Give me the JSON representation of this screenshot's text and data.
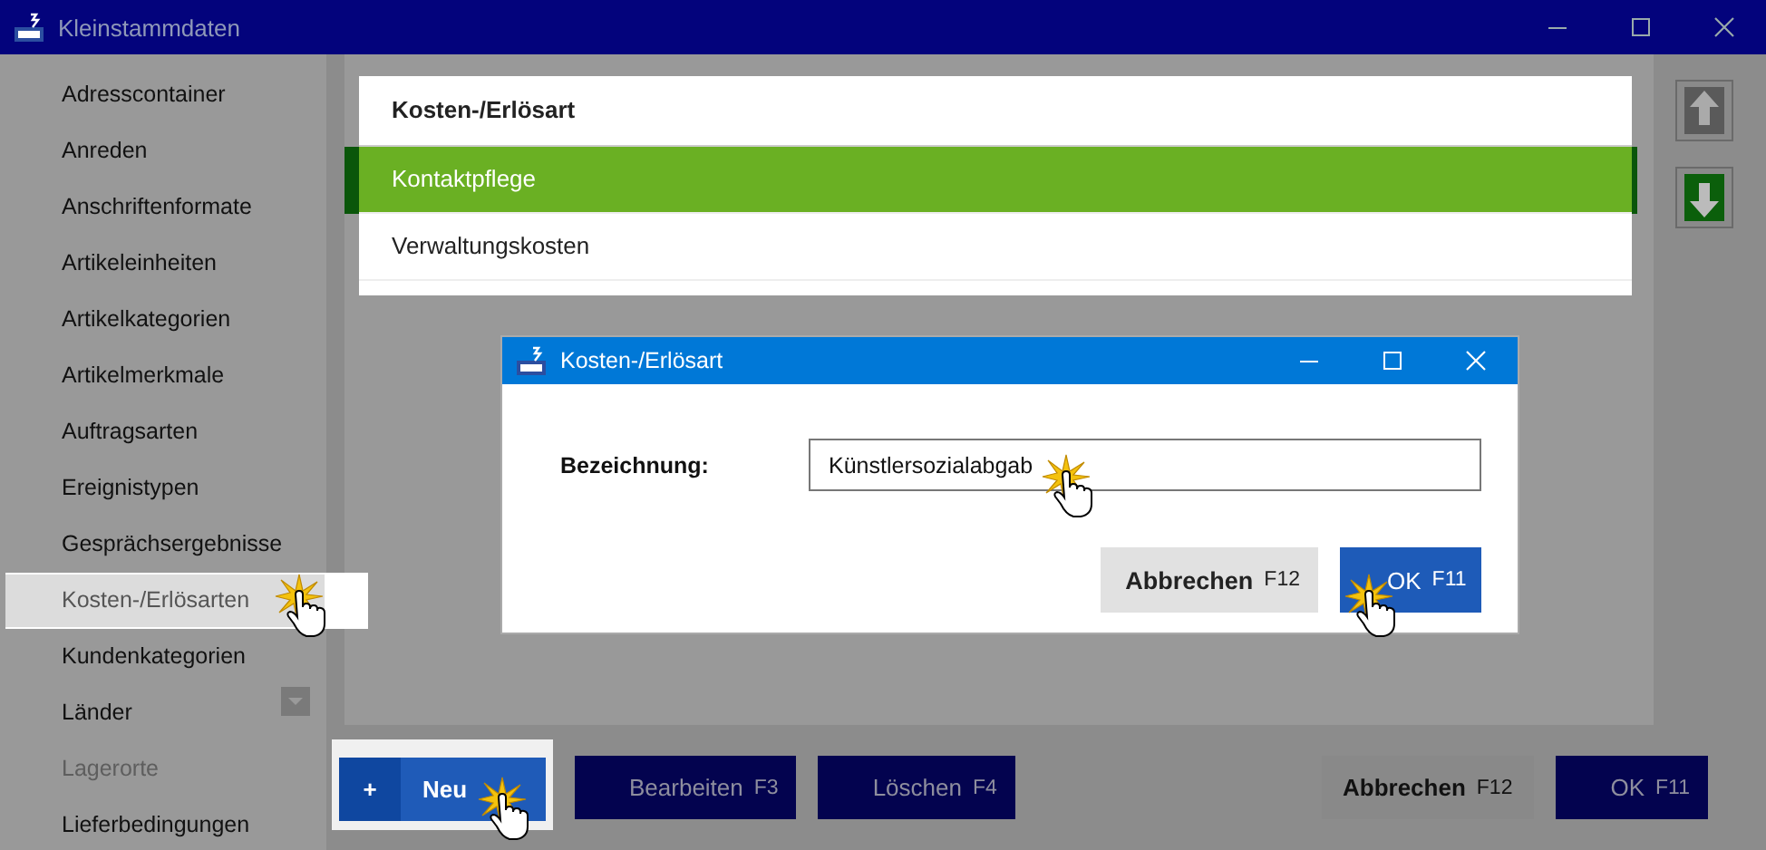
{
  "window": {
    "title": "Kleinstammdaten"
  },
  "sidebar": {
    "items": [
      {
        "label": "Adresscontainer",
        "selected": false,
        "disabled": false
      },
      {
        "label": "Anreden",
        "selected": false,
        "disabled": false
      },
      {
        "label": "Anschriftenformate",
        "selected": false,
        "disabled": false
      },
      {
        "label": "Artikeleinheiten",
        "selected": false,
        "disabled": false
      },
      {
        "label": "Artikelkategorien",
        "selected": false,
        "disabled": false
      },
      {
        "label": "Artikelmerkmale",
        "selected": false,
        "disabled": false
      },
      {
        "label": "Auftragsarten",
        "selected": false,
        "disabled": false
      },
      {
        "label": "Ereignistypen",
        "selected": false,
        "disabled": false
      },
      {
        "label": "Gesprächsergebnisse",
        "selected": false,
        "disabled": false
      },
      {
        "label": "Kosten-/Erlösarten",
        "selected": true,
        "disabled": false,
        "cursor": true
      },
      {
        "label": "Kundenkategorien",
        "selected": false,
        "disabled": false
      },
      {
        "label": "Länder",
        "selected": false,
        "disabled": false
      },
      {
        "label": "Lagerorte",
        "selected": false,
        "disabled": true
      },
      {
        "label": "Lieferbedingungen",
        "selected": false,
        "disabled": false
      }
    ]
  },
  "list": {
    "rows": [
      {
        "kind": "header",
        "label": "Kosten-/Erlösart",
        "selected": false
      },
      {
        "kind": "row",
        "label": "Kontaktpflege",
        "selected": true
      },
      {
        "kind": "row",
        "label": "Verwaltungskosten",
        "selected": false
      }
    ]
  },
  "move_buttons": [
    {
      "kind": "up",
      "disabled": true
    },
    {
      "kind": "down",
      "disabled": false
    }
  ],
  "buttons": [
    {
      "kind": "new",
      "icon": "+",
      "label": "Neu",
      "cursor": true
    },
    {
      "kind": "dim",
      "label": "Bearbeiten",
      "key": "F3"
    },
    {
      "kind": "dim",
      "label": "Löschen",
      "key": "F4"
    },
    {
      "kind": "grey",
      "label": "Abbrechen",
      "key": "F12"
    },
    {
      "kind": "dim",
      "label": "OK",
      "key": "F11"
    }
  ],
  "dialog": {
    "title": "Kosten-/Erlösart",
    "field": {
      "label": "Bezeichnung:",
      "value": "Künstlersozialabgab",
      "cursor": true
    },
    "buttons": [
      {
        "kind": "grey",
        "label": "Abbrechen",
        "key": "F12",
        "cursor": false
      },
      {
        "kind": "blue",
        "label": "OK",
        "key": "F11",
        "cursor": true
      }
    ]
  }
}
